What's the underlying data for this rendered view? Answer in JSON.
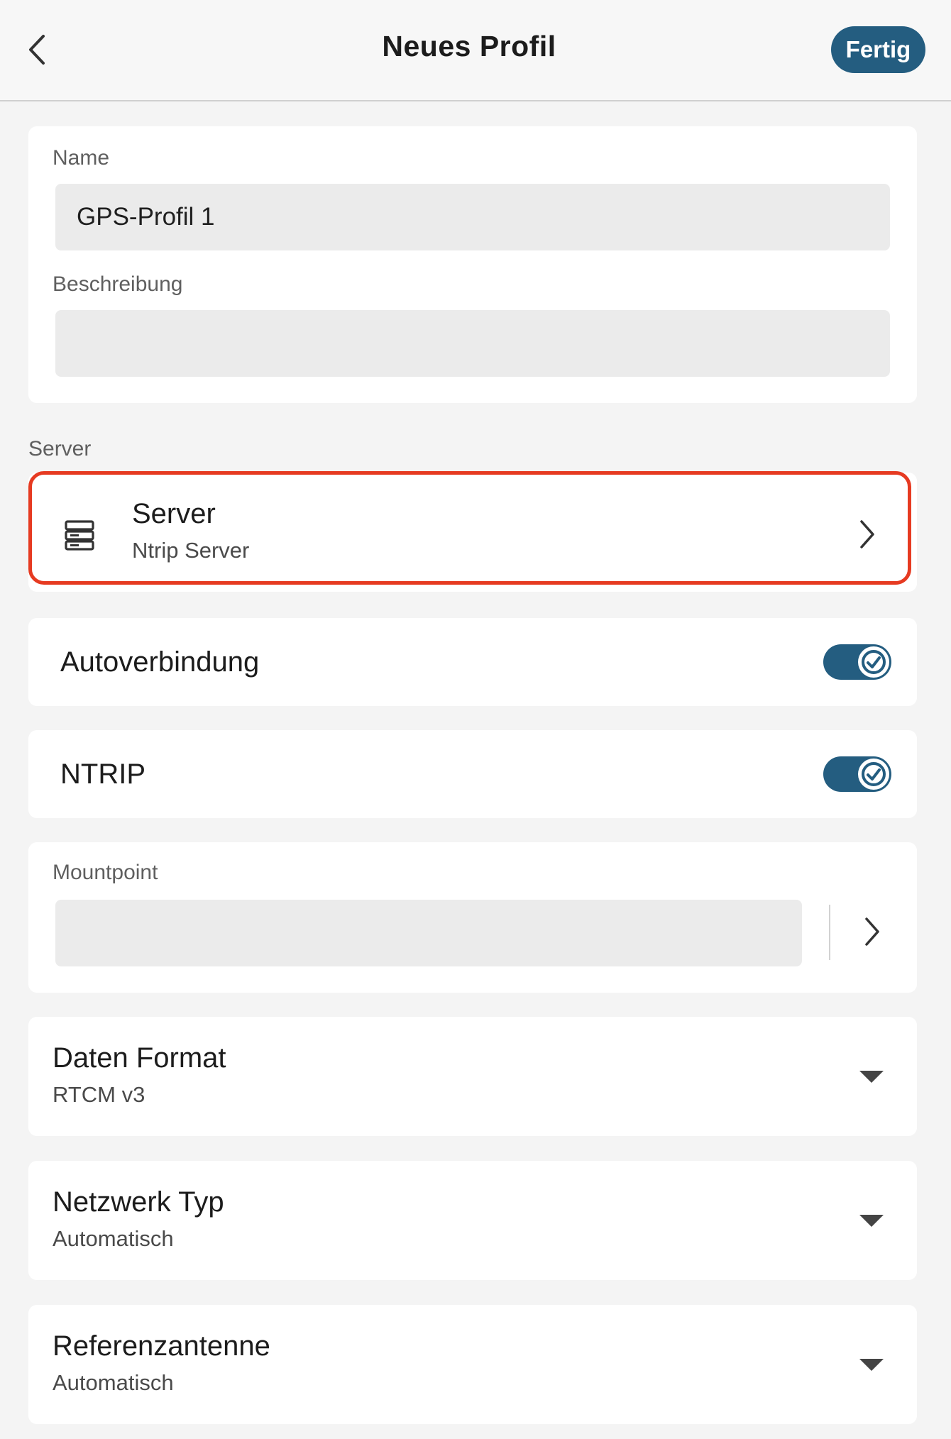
{
  "header": {
    "title": "Neues Profil",
    "done_label": "Fertig"
  },
  "general": {
    "name_label": "Name",
    "name_value": "GPS-Profil 1",
    "description_label": "Beschreibung",
    "description_value": ""
  },
  "server_section": {
    "label": "Server",
    "row_title": "Server",
    "row_subtitle": "Ntrip Server"
  },
  "toggles": [
    {
      "label": "Autoverbindung",
      "on": true
    },
    {
      "label": "NTRIP",
      "on": true
    }
  ],
  "mountpoint": {
    "label": "Mountpoint",
    "value": ""
  },
  "dropdowns": [
    {
      "title": "Daten Format",
      "value": "RTCM v3"
    },
    {
      "title": "Netzwerk Typ",
      "value": "Automatisch"
    },
    {
      "title": "Referenzantenne",
      "value": "Automatisch"
    }
  ],
  "colors": {
    "accent": "#245d80",
    "highlight": "#e63a21",
    "background": "#f4f4f4"
  },
  "icons": {
    "back": "chevron-left-icon",
    "server": "server-icon",
    "chevron": "chevron-right-icon",
    "dropdown": "dropdown-arrow-icon",
    "check": "check-icon"
  }
}
